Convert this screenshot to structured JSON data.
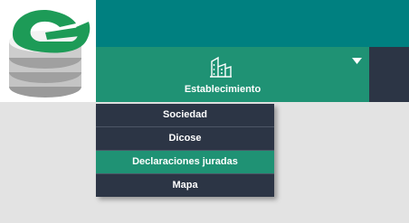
{
  "nav": {
    "tab_label": "Establecimiento",
    "tab_icon": "building-icon",
    "caret_icon": "caret-down-icon"
  },
  "dropdown": {
    "items": [
      {
        "label": "Sociedad",
        "active": false
      },
      {
        "label": "Dicose",
        "active": false
      },
      {
        "label": "Declaraciones juradas",
        "active": true
      },
      {
        "label": "Mapa",
        "active": false
      }
    ]
  },
  "colors": {
    "topbar": "#008080",
    "tab": "#1f9274",
    "dark": "#2c3545",
    "background": "#e3e3e3",
    "logo_green": "#1d9b57"
  }
}
